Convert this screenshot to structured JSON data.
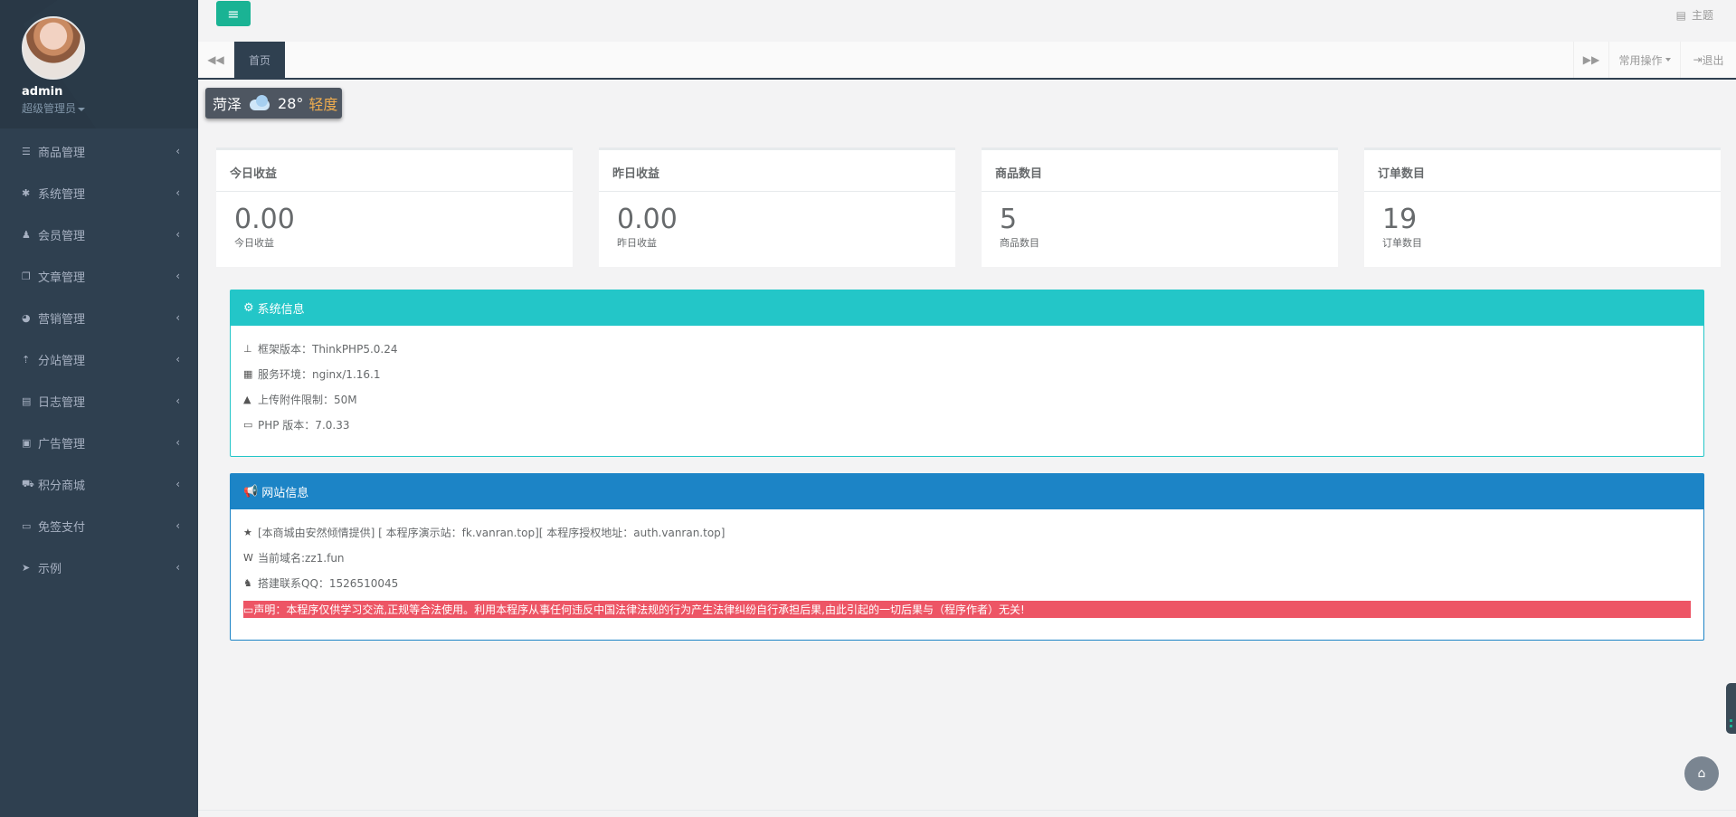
{
  "user": {
    "name": "admin",
    "role": "超级管理员"
  },
  "sidebar": {
    "items": [
      {
        "label": "商品管理",
        "icon": "bars-icon"
      },
      {
        "label": "系统管理",
        "icon": "gear-icon"
      },
      {
        "label": "会员管理",
        "icon": "users-icon"
      },
      {
        "label": "文章管理",
        "icon": "copy-icon"
      },
      {
        "label": "营销管理",
        "icon": "pie-chart-icon"
      },
      {
        "label": "分站管理",
        "icon": "upload-icon"
      },
      {
        "label": "日志管理",
        "icon": "list-icon"
      },
      {
        "label": "广告管理",
        "icon": "image-icon"
      },
      {
        "label": "积分商城",
        "icon": "cart-icon"
      },
      {
        "label": "免签支付",
        "icon": "credit-card-icon"
      },
      {
        "label": "示例",
        "icon": "paper-plane-icon"
      }
    ]
  },
  "header": {
    "theme_label": "主题"
  },
  "tabs": {
    "active": "首页",
    "ops_label": "常用操作",
    "logout_label": "退出"
  },
  "weather": {
    "city": "菏泽",
    "temp": "28°",
    "air": "轻度"
  },
  "stats": [
    {
      "title": "今日收益",
      "value": "0.00",
      "sub": "今日收益"
    },
    {
      "title": "昨日收益",
      "value": "0.00",
      "sub": "昨日收益"
    },
    {
      "title": "商品数目",
      "value": "5",
      "sub": "商品数目"
    },
    {
      "title": "订单数目",
      "value": "19",
      "sub": "订单数目"
    }
  ],
  "system_info": {
    "title": "系统信息",
    "rows": [
      "框架版本：ThinkPHP5.0.24",
      "服务环境：nginx/1.16.1",
      "上传附件限制：50M",
      "PHP 版本：7.0.33"
    ]
  },
  "site_info": {
    "title": "网站信息",
    "rows": [
      "[本商城由安然倾情提供] [ 本程序演示站：fk.vanran.top][ 本程序授权地址：auth.vanran.top]",
      "当前域名:zz1.fun",
      "搭建联系QQ：1526510045"
    ],
    "notice": "声明：本程序仅供学习交流,正规等合法使用。利用本程序从事任何违反中国法律法规的行为产生法律纠纷自行承担后果,由此引起的一切后果与（程序作者）无关!"
  },
  "colors": {
    "sidebar": "#2f4050",
    "accent": "#1ab394",
    "sys_panel": "#23c6c8",
    "site_panel": "#1c84c6",
    "notice": "#ed5565"
  }
}
